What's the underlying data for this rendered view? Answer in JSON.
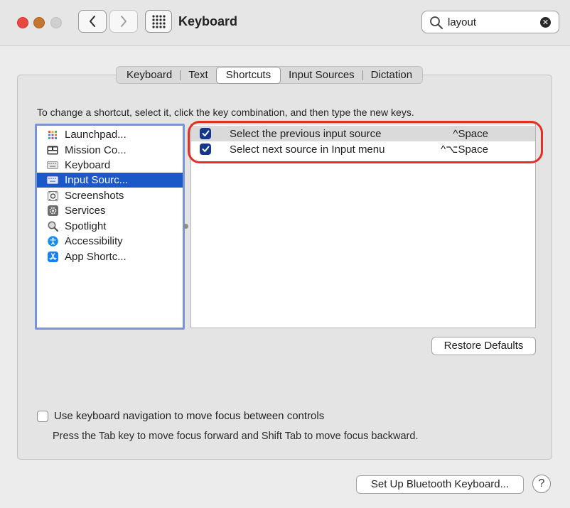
{
  "window": {
    "title": "Keyboard"
  },
  "search": {
    "value": "layout"
  },
  "tabs": [
    {
      "label": "Keyboard"
    },
    {
      "label": "Text"
    },
    {
      "label": "Shortcuts"
    },
    {
      "label": "Input Sources"
    },
    {
      "label": "Dictation"
    }
  ],
  "instructions": "To change a shortcut, select it, click the key combination, and then type the new keys.",
  "categories": [
    {
      "label": "Launchpad...",
      "icon": "launchpad-icon"
    },
    {
      "label": "Mission Co...",
      "icon": "mission-control-icon"
    },
    {
      "label": "Keyboard",
      "icon": "keyboard-icon"
    },
    {
      "label": "Input Sourc...",
      "icon": "input-sources-icon"
    },
    {
      "label": "Screenshots",
      "icon": "screenshot-icon"
    },
    {
      "label": "Services",
      "icon": "gear-icon"
    },
    {
      "label": "Spotlight",
      "icon": "magnifier-icon"
    },
    {
      "label": "Accessibility",
      "icon": "accessibility-icon"
    },
    {
      "label": "App Shortc...",
      "icon": "app-store-icon"
    }
  ],
  "shortcuts": [
    {
      "label": "Select the previous input source",
      "keys": "^Space"
    },
    {
      "label": "Select next source in Input menu",
      "keys": "^⌥Space"
    }
  ],
  "buttons": {
    "restore_defaults": "Restore Defaults",
    "setup_bluetooth": "Set Up Bluetooth Keyboard...",
    "help": "?"
  },
  "keyboard_navigation": {
    "label": "Use keyboard navigation to move focus between controls",
    "help": "Press the Tab key to move focus forward and Shift Tab to move focus backward."
  },
  "colors": {
    "selection": "#1c59c8",
    "checkbox": "#14378a",
    "highlight": "#e33022"
  }
}
